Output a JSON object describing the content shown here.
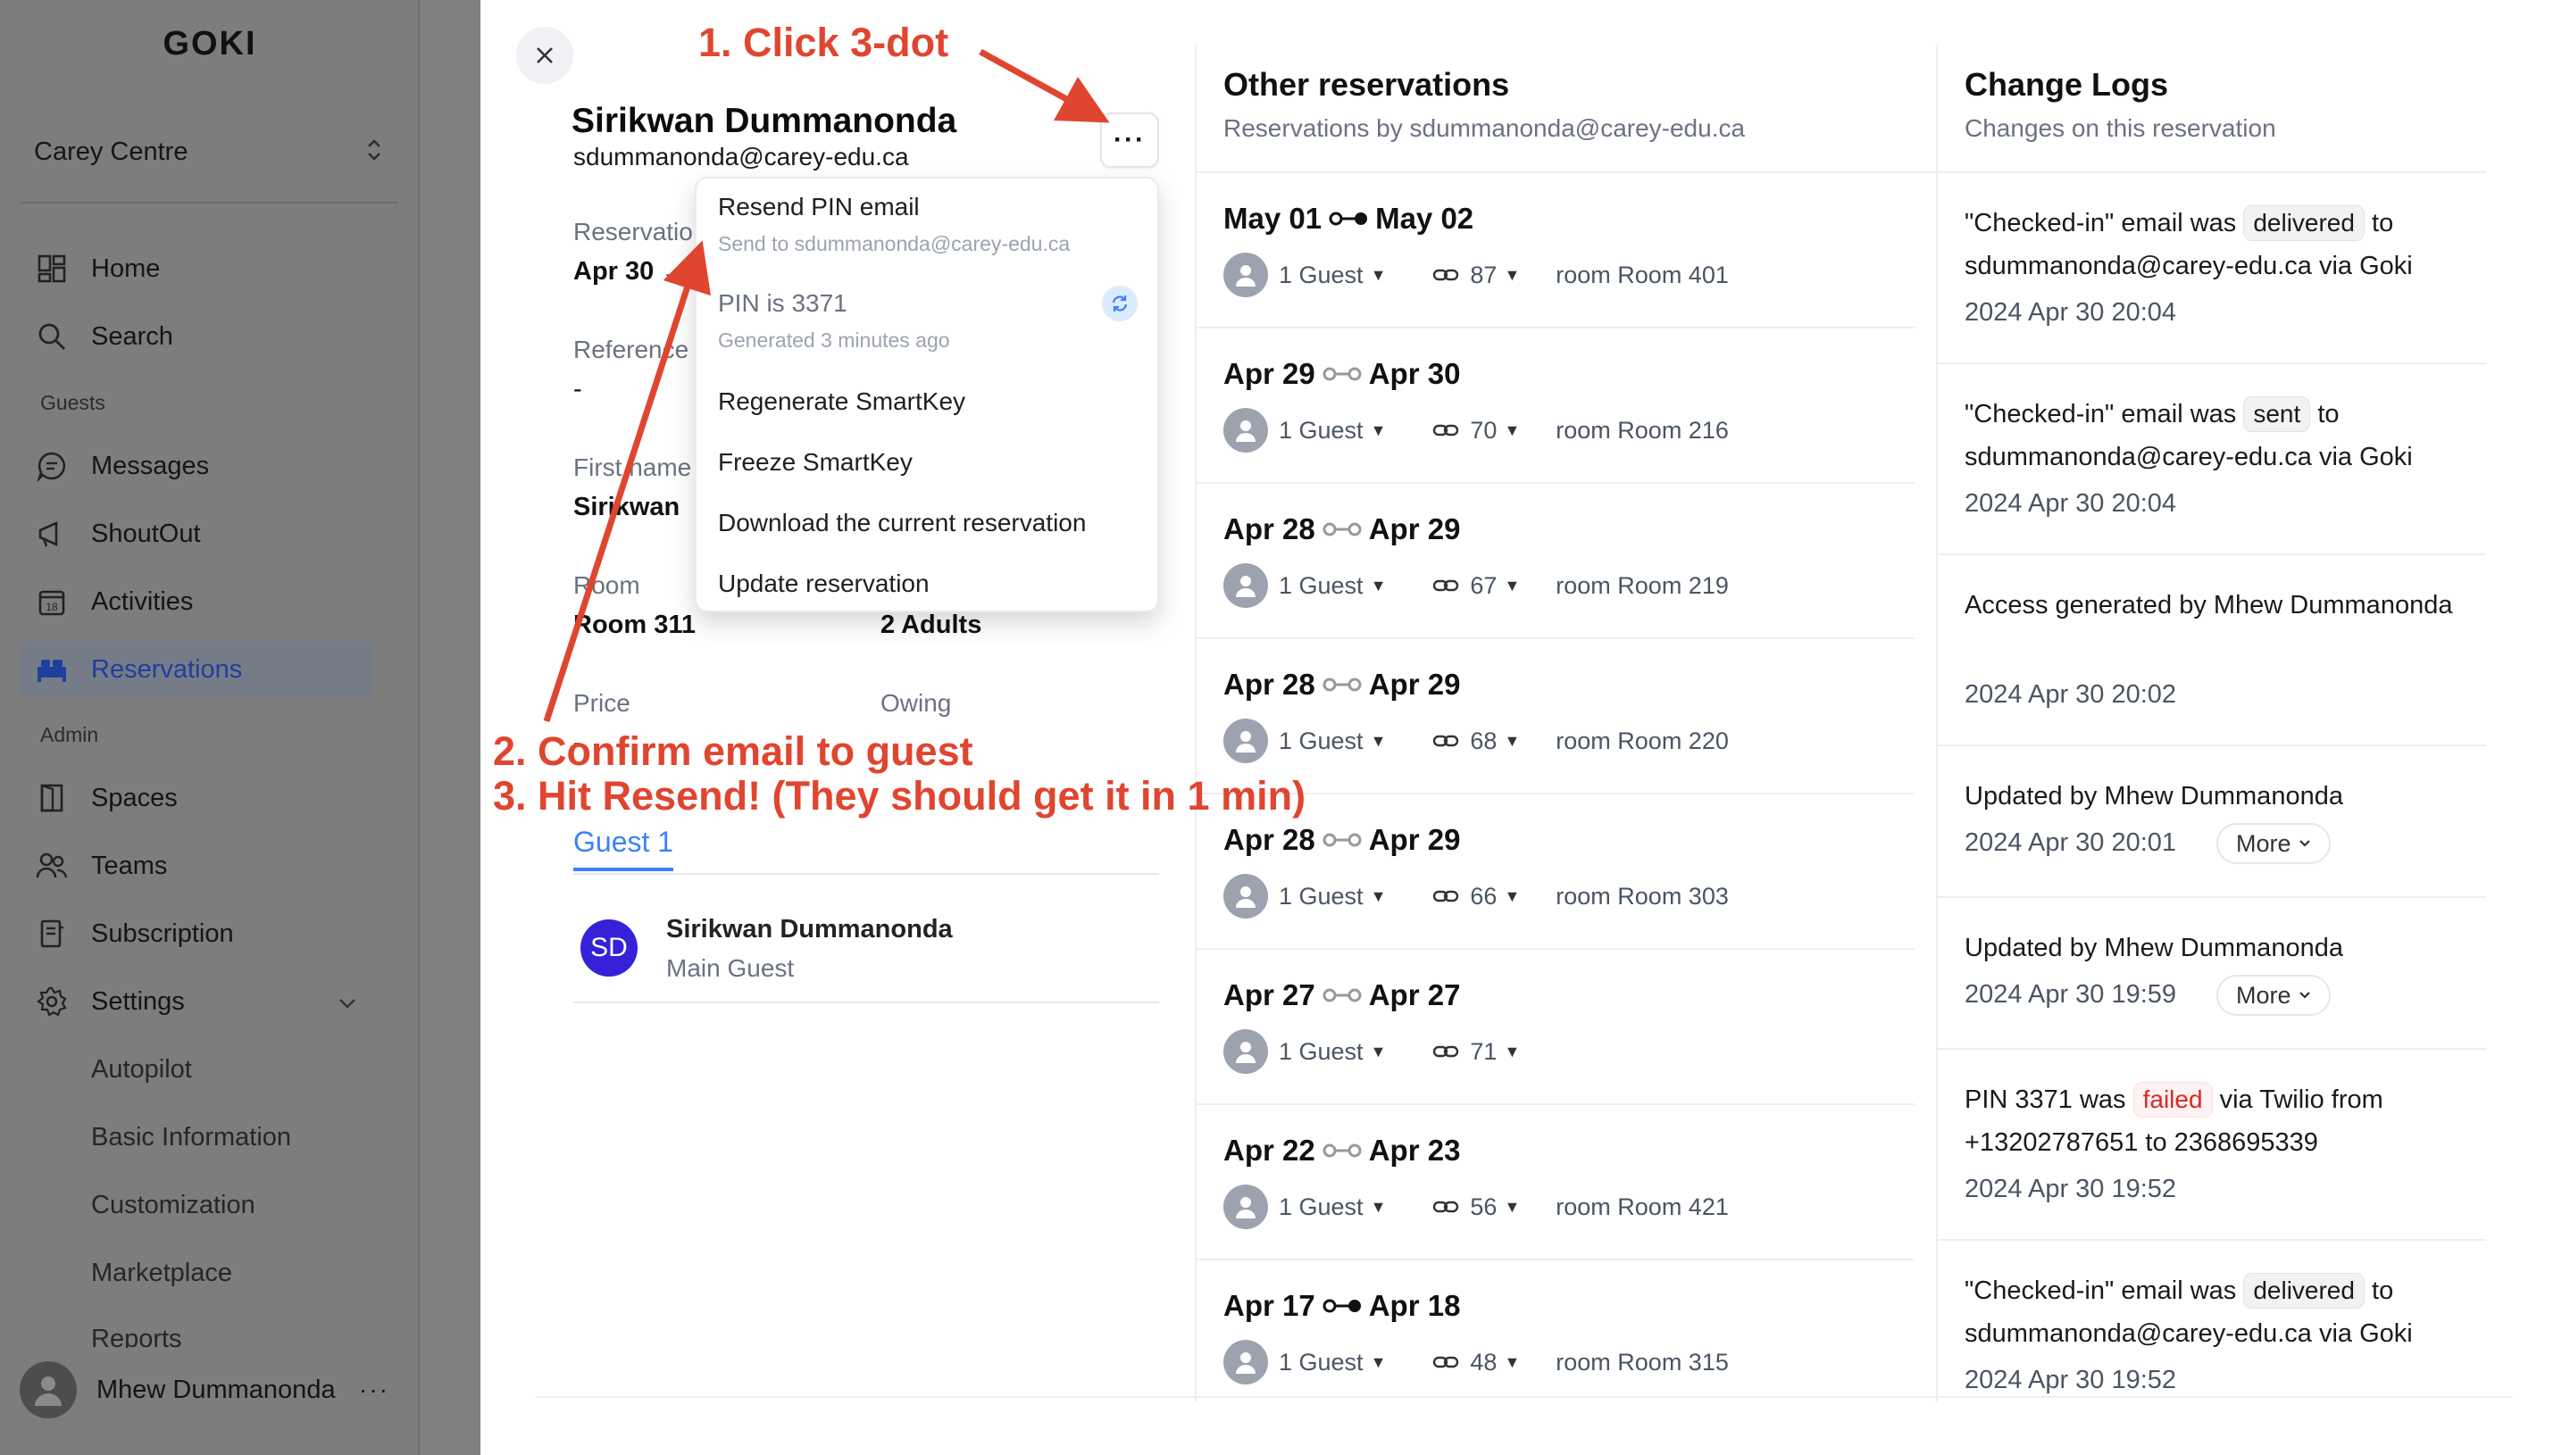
{
  "sidebar": {
    "logo": "GOKI",
    "org": "Carey Centre",
    "nav_top": [
      {
        "label": "Home",
        "icon": "home-icon"
      },
      {
        "label": "Search",
        "icon": "search-icon"
      }
    ],
    "section_guests": "Guests",
    "nav_guests": [
      {
        "label": "Messages",
        "icon": "message-icon"
      },
      {
        "label": "ShoutOut",
        "icon": "megaphone-icon"
      },
      {
        "label": "Activities",
        "icon": "calendar-icon"
      },
      {
        "label": "Reservations",
        "icon": "bed-icon",
        "active": true
      }
    ],
    "section_admin": "Admin",
    "nav_admin": [
      {
        "label": "Spaces",
        "icon": "door-icon"
      },
      {
        "label": "Teams",
        "icon": "users-icon"
      },
      {
        "label": "Subscription",
        "icon": "receipt-icon"
      },
      {
        "label": "Settings",
        "icon": "gear-icon"
      }
    ],
    "settings_sub": [
      "Autopilot",
      "Basic Information",
      "Customization",
      "Marketplace",
      "Reports"
    ],
    "user_name": "Mhew Dummanonda",
    "user_more": "···"
  },
  "guest": {
    "name": "Sirikwan Dummanonda",
    "email": "sdummanonda@carey-edu.ca",
    "fields": {
      "reservation_label": "Reservatio",
      "reservation_value": "Apr 30 →",
      "reference_label": "Reference",
      "reference_value": "-",
      "first_name_label": "First name",
      "first_name_value": "Sirikwan",
      "room_label": "Room",
      "room_value": "Room 311",
      "guests_value": "2 Adults",
      "price_label": "Price",
      "price_value": "-",
      "owing_label": "Owing"
    },
    "tab": "Guest 1",
    "main_guest": {
      "initials": "SD",
      "name": "Sirikwan Dummanonda",
      "role": "Main Guest"
    }
  },
  "menu": {
    "resend_label": "Resend PIN email",
    "resend_sub": "Send to sdummanonda@carey-edu.ca",
    "pin_label": "PIN is 3371",
    "pin_sub": "Generated 3 minutes ago",
    "regenerate": "Regenerate SmartKey",
    "freeze": "Freeze SmartKey",
    "download": "Download the current reservation",
    "update": "Update reservation"
  },
  "other_reservations": {
    "title": "Other reservations",
    "subtitle": "Reservations by sdummanonda@carey-edu.ca",
    "items": [
      {
        "from": "May 01",
        "to": "May 02",
        "guests": "1 Guest",
        "code": "87",
        "room": "room Room 401"
      },
      {
        "from": "Apr 29",
        "to": "Apr 30",
        "guests": "1 Guest",
        "code": "70",
        "room": "room Room 216"
      },
      {
        "from": "Apr 28",
        "to": "Apr 29",
        "guests": "1 Guest",
        "code": "67",
        "room": "room Room 219"
      },
      {
        "from": "Apr 28",
        "to": "Apr 29",
        "guests": "1 Guest",
        "code": "68",
        "room": "room Room 220"
      },
      {
        "from": "Apr 28",
        "to": "Apr 29",
        "guests": "1 Guest",
        "code": "66",
        "room": "room Room 303"
      },
      {
        "from": "Apr 27",
        "to": "Apr 27",
        "guests": "1 Guest",
        "code": "71",
        "room": ""
      },
      {
        "from": "Apr 22",
        "to": "Apr 23",
        "guests": "1 Guest",
        "code": "56",
        "room": "room Room 421"
      },
      {
        "from": "Apr 17",
        "to": "Apr 18",
        "guests": "1 Guest",
        "code": "48",
        "room": "room Room 315"
      }
    ]
  },
  "change_logs": {
    "title": "Change Logs",
    "subtitle": "Changes on this reservation",
    "entries": [
      {
        "pre": "\"Checked-in\" email was",
        "pill": "delivered",
        "post": "to sdummanonda@carey-edu.ca via Goki",
        "time": "2024 Apr 30 20:04"
      },
      {
        "pre": "\"Checked-in\" email was",
        "pill": "sent",
        "post": "to sdummanonda@carey-edu.ca via Goki",
        "time": "2024 Apr 30 20:04"
      },
      {
        "text": "Access generated by Mhew Dummanonda",
        "time": "2024 Apr 30 20:02"
      },
      {
        "text": "Updated by Mhew Dummanonda",
        "time": "2024 Apr 30 20:01",
        "more": "More"
      },
      {
        "text": "Updated by Mhew Dummanonda",
        "time": "2024 Apr 30 19:59",
        "more": "More"
      },
      {
        "pre": "PIN 3371 was",
        "pill": "failed",
        "post": "via Twilio from +13202787651 to 2368695339",
        "time": "2024 Apr 30 19:52"
      },
      {
        "pre": "\"Checked-in\" email was",
        "pill": "delivered",
        "post": "to sdummanonda@carey-edu.ca via Goki",
        "time": "2024 Apr 30 19:52"
      }
    ]
  },
  "annotations": {
    "step1": "1. Click 3-dot",
    "step2": "2. Confirm email to guest",
    "step3": "3. Hit Resend! (They should get it in 1 min)",
    "color": "#e0452f"
  },
  "colors": {
    "accent": "#3b82f6",
    "avatar_sd": "#3421d8",
    "failed": "#dc2626"
  }
}
